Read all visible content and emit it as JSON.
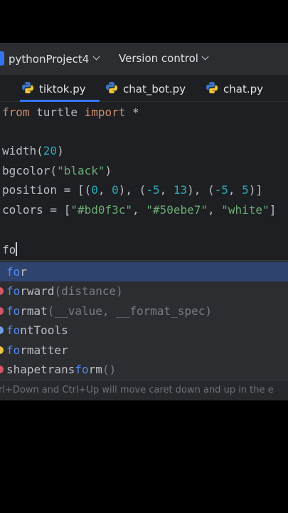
{
  "titlebar": {
    "project": "pythonProject4",
    "vcs": "Version control"
  },
  "tabs": [
    {
      "label": "tiktok.py",
      "active": true
    },
    {
      "label": "chat_bot.py",
      "active": false
    },
    {
      "label": "chat.py",
      "active": false
    }
  ],
  "code": {
    "line1": {
      "kw1": "from",
      "mod": " turtle ",
      "kw2": "import",
      "rest": " *"
    },
    "line2": {
      "fn": "width(",
      "n": "20",
      "close": ")"
    },
    "line3": {
      "fn": "bgcolor(",
      "s": "\"black\"",
      "close": ")"
    },
    "line4": {
      "a": "position = [(",
      "n1": "0",
      "c1": ", ",
      "n2": "0",
      "c2": "), (",
      "n3": "-5",
      "c3": ", ",
      "n4": "13",
      "c4": "), (",
      "n5": "-5",
      "c5": ", ",
      "n6": "5",
      "c6": ")]"
    },
    "line5": {
      "a": "colors = [",
      "s1": "\"#bd0f3c\"",
      "c1": ", ",
      "s2": "\"#50ebe7\"",
      "c2": ", ",
      "s3": "\"white\"",
      "c3": "]"
    },
    "line6": {
      "typed": "fo"
    }
  },
  "completion": {
    "items": [
      {
        "match": "fo",
        "rest": "r",
        "tail": "",
        "dot_color": ""
      },
      {
        "match": "fo",
        "rest": "rward",
        "tail": "(distance)",
        "dot_color": "#d8566a"
      },
      {
        "match": "fo",
        "rest": "rmat",
        "tail": "(__value, __format_spec)",
        "dot_color": "#d8566a"
      },
      {
        "match": "fo",
        "rest": "ntTools",
        "tail": "",
        "dot_color": "#6f9fe8"
      },
      {
        "match": "fo",
        "rest": "rmatter",
        "tail": "",
        "dot_color": "#e8c442"
      },
      {
        "prefix": "shapetrans",
        "match": "fo",
        "rest": "rm",
        "tail": "()",
        "dot_color": "#d8566a"
      }
    ],
    "hint": "rl+Down and Ctrl+Up will move caret down and up in the e"
  }
}
